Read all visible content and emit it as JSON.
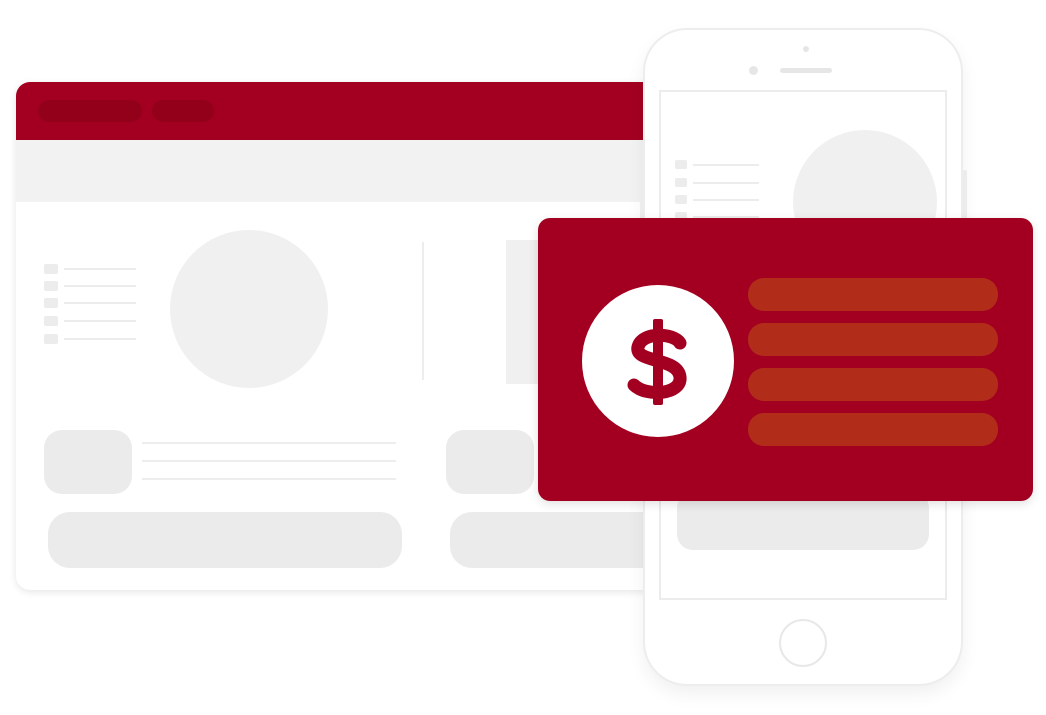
{
  "colors": {
    "brand": "#a30021",
    "brand_dark": "#920019",
    "payment_line": "#b12d1a",
    "placeholder": "#ebebeb",
    "background": "#ffffff"
  },
  "icons": {
    "currency": "dollar-icon"
  },
  "payment_card": {
    "placeholder_line_count": 4
  }
}
